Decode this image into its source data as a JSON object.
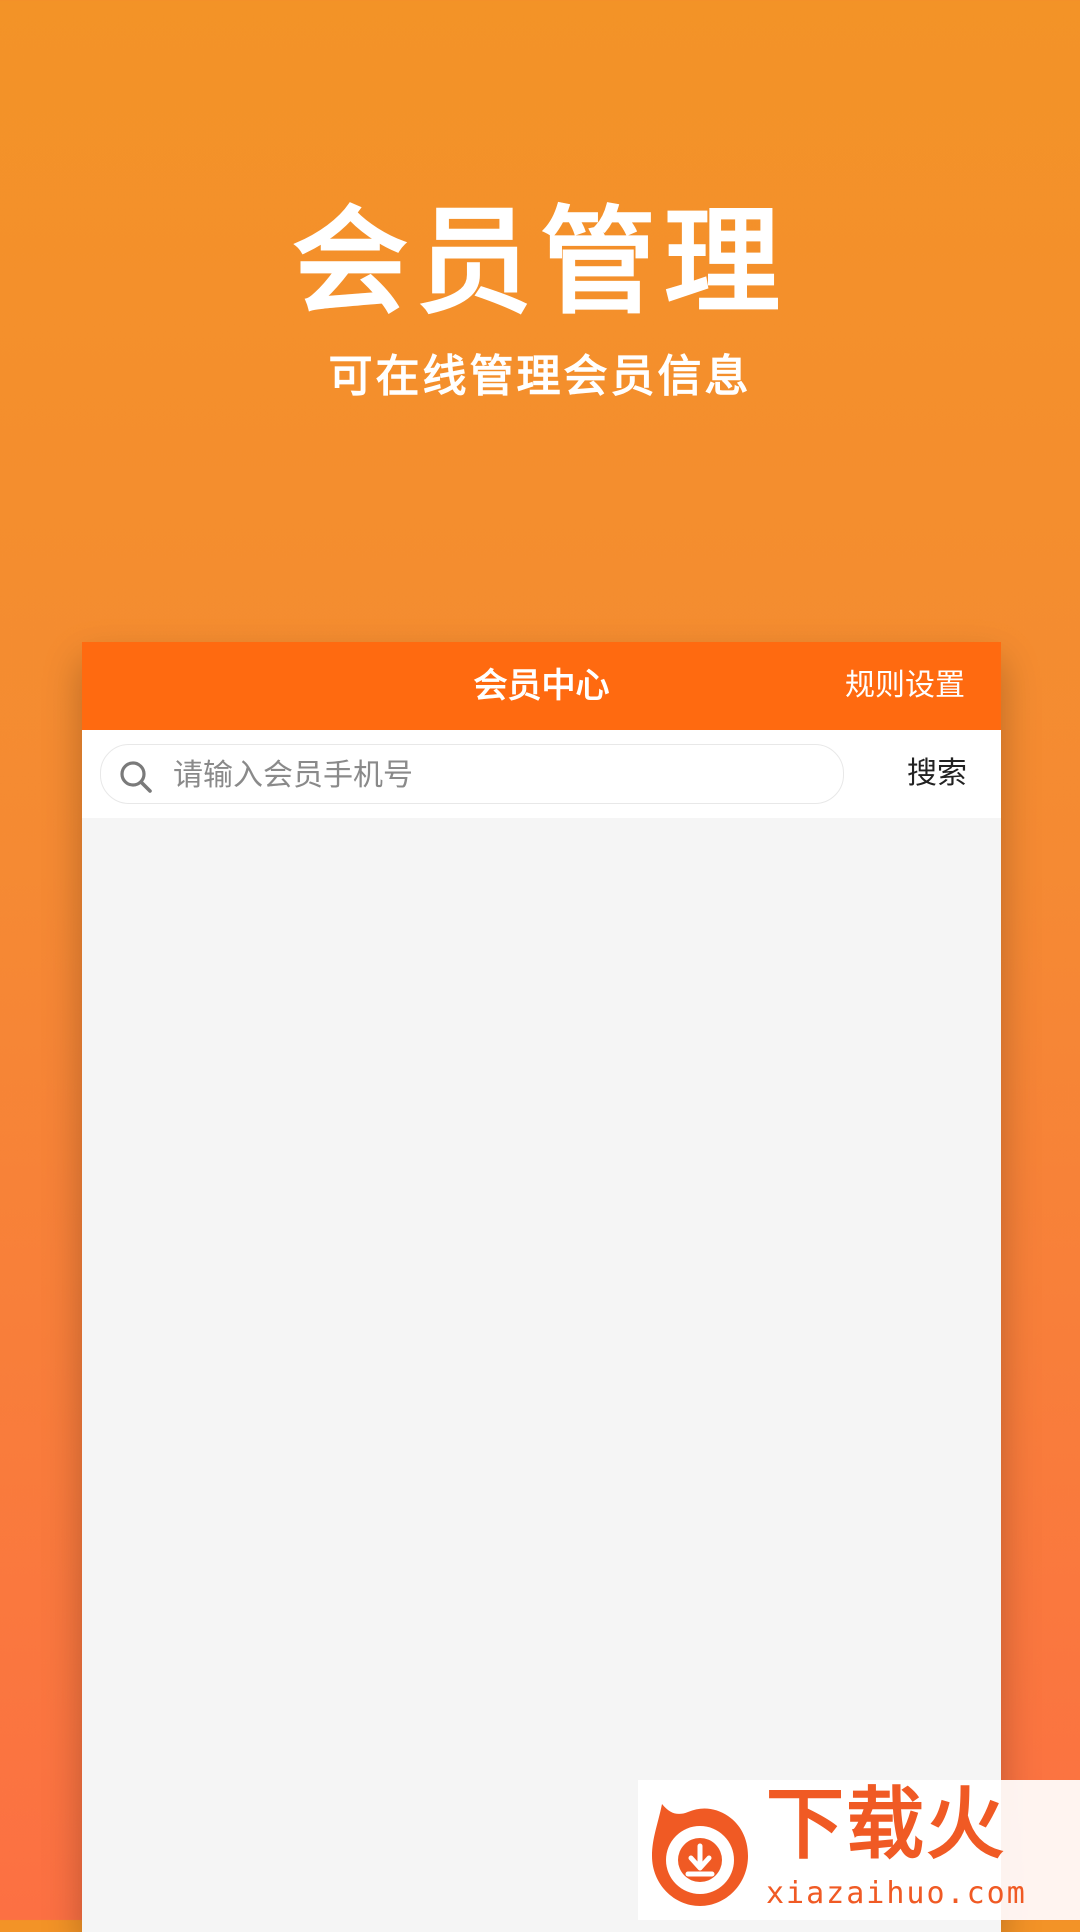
{
  "promo": {
    "headline": "会员管理",
    "subheadline": "可在线管理会员信息"
  },
  "app": {
    "title": "会员中心",
    "rules_link": "规则设置",
    "search": {
      "placeholder": "请输入会员手机号",
      "value": "",
      "button_label": "搜索"
    }
  },
  "watermark": {
    "brand": "下载火",
    "url": "xiazaihuo.com"
  },
  "colors": {
    "accent": "#FF6A10",
    "background_top": "#F39327",
    "background_bottom": "#FC7043",
    "content_bg": "#F5F5F5"
  },
  "icons": {
    "search": "search-icon",
    "watermark_logo": "download-flame-logo-icon"
  }
}
